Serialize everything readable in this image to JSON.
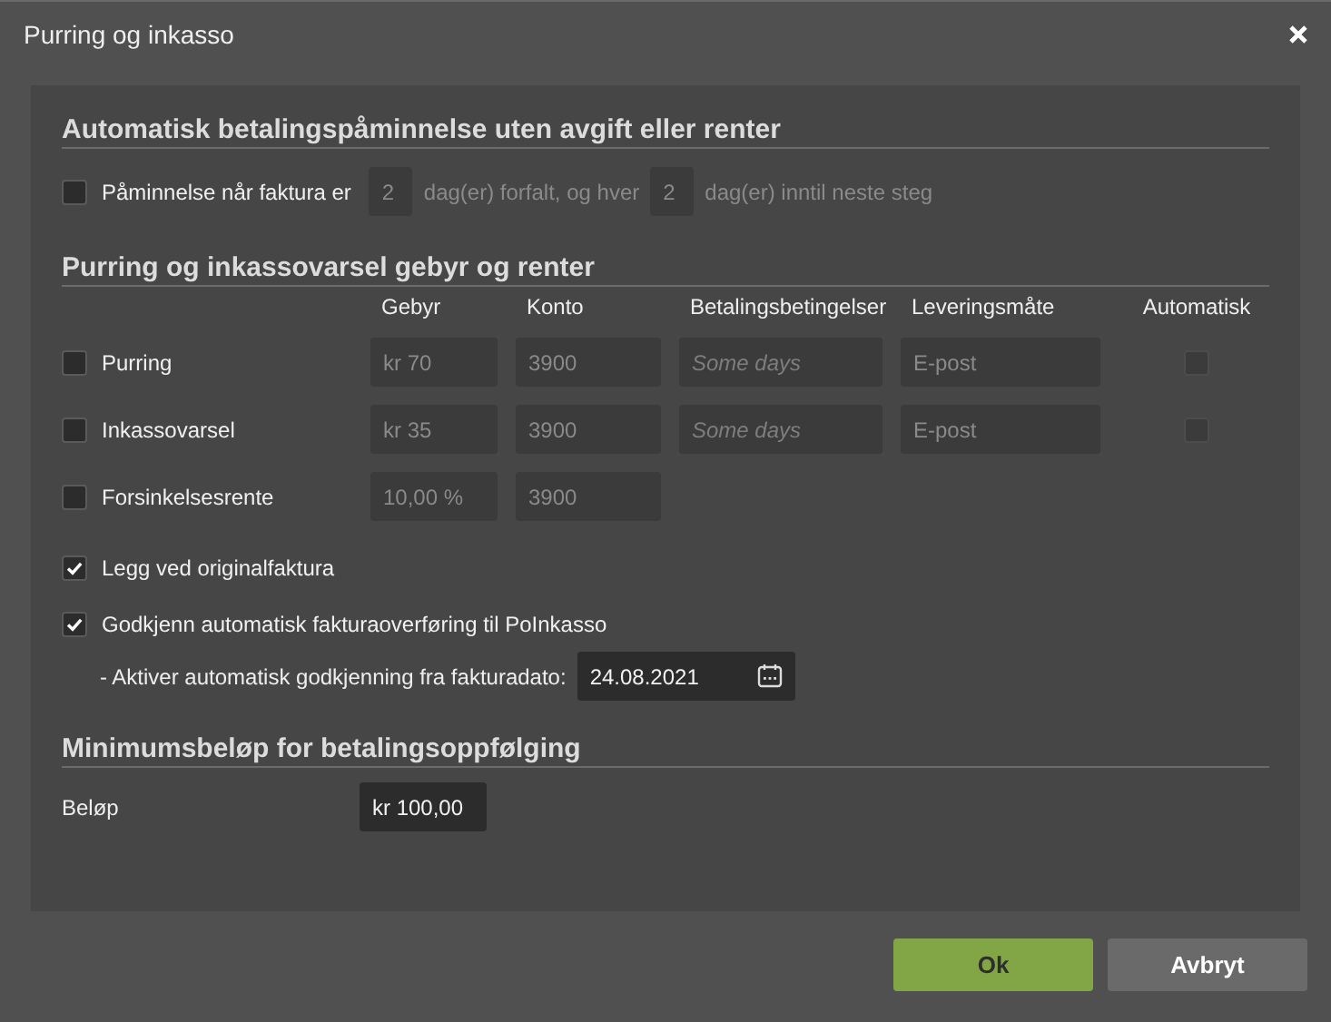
{
  "window": {
    "title": "Purring og inkasso"
  },
  "reminder": {
    "heading": "Automatisk betalingspåminnelse uten avgift eller renter",
    "label": "Påminnelse når faktura er",
    "checked": false,
    "disabled": true,
    "days_due": "2",
    "text_1": "dag(er) forfalt, og hver",
    "days_interval": "2",
    "text_2": "dag(er) inntil neste steg"
  },
  "fees": {
    "heading": "Purring og inkassovarsel gebyr og renter",
    "columns": [
      "Gebyr",
      "Konto",
      "Betalingsbetingelser",
      "Leveringsmåte",
      "Automatisk"
    ],
    "rows": [
      {
        "label": "Purring",
        "checked": false,
        "disabled": true,
        "fee": "kr 70",
        "account": "3900",
        "terms": {
          "placeholder": "Some days"
        },
        "delivery": "E-post",
        "automatic": {
          "checked": false
        }
      },
      {
        "label": "Inkassovarsel",
        "checked": false,
        "disabled": true,
        "fee": "kr 35",
        "account": "3900",
        "terms": {
          "placeholder": "Some days"
        },
        "delivery": "E-post",
        "automatic": {
          "checked": false
        }
      },
      {
        "label": "Forsinkelsesrente",
        "checked": false,
        "disabled": true,
        "fee": "10,00 %",
        "account": "3900"
      }
    ]
  },
  "options": [
    {
      "label": "Legg ved originalfaktura",
      "checked": true
    },
    {
      "label": "Godkjenn automatisk fakturaoverføring til PoInkasso",
      "checked": true
    }
  ],
  "auto_approve": {
    "label": "- Aktiver automatisk godkjenning fra fakturadato:",
    "value": "24.08.2021"
  },
  "minimum": {
    "heading": "Minimumsbeløp for betalingsoppfølging",
    "label": "Beløp",
    "value": "kr 100,00"
  },
  "buttons": [
    {
      "label": "Ok",
      "kind": "primary"
    },
    {
      "label": "Avbryt",
      "kind": "secondary"
    }
  ]
}
